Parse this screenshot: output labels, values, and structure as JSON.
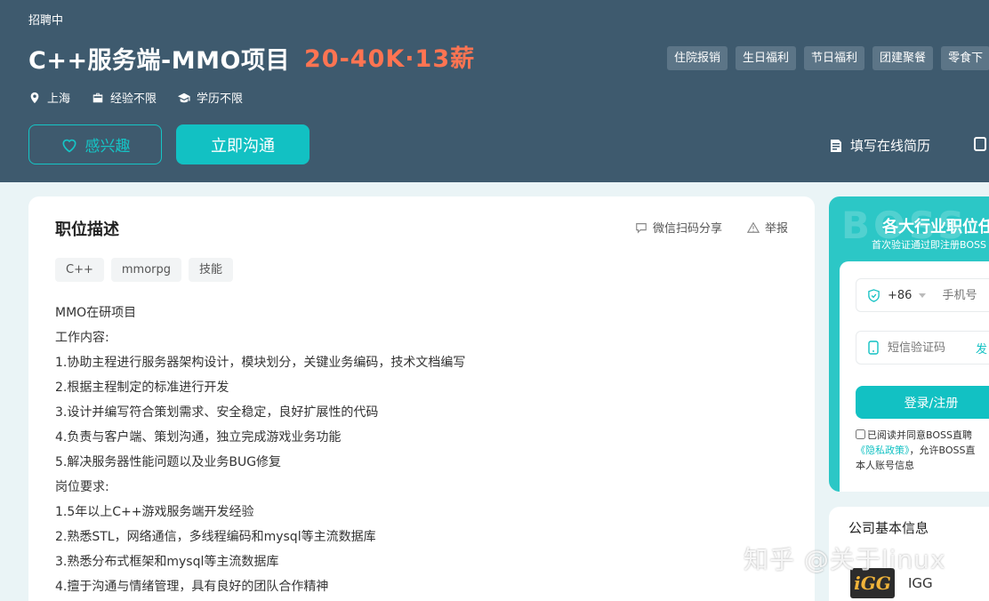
{
  "header": {
    "status": "招聘中",
    "job_title": "C++服务端-MMO项目",
    "salary": "20-40K·13薪",
    "benefits": [
      "住院报销",
      "生日福利",
      "节日福利",
      "团建聚餐",
      "零食下"
    ],
    "meta": {
      "location": "上海",
      "experience": "经验不限",
      "education": "学历不限"
    },
    "interest_label": "感兴趣",
    "chat_label": "立即沟通",
    "resume_label": "填写在线简历"
  },
  "job": {
    "section_title": "职位描述",
    "share_label": "微信扫码分享",
    "report_label": "举报",
    "skill_tags": [
      "C++",
      "mmorpg",
      "技能"
    ],
    "description": [
      "MMO在研项目",
      "工作内容:",
      "1.协助主程进行服务器架构设计，模块划分，关键业务编码，技术文档编写",
      "2.根据主程制定的标准进行开发",
      "3.设计并编写符合策划需求、安全稳定，良好扩展性的代码",
      "4.负责与客户端、策划沟通，独立完成游戏业务功能",
      "5.解决服务器性能问题以及业务BUG修复",
      "岗位要求:",
      "1.5年以上C++游戏服务端开发经验",
      "2.熟悉STL，网络通信，多线程编码和mysql等主流数据库",
      "3.熟悉分布式框架和mysql等主流数据库",
      "4.擅于沟通与情绪管理，具有良好的团队合作精神"
    ]
  },
  "login": {
    "watermark": "BOSS",
    "headline": "各大行业职位任",
    "subline": "首次验证通过即注册BOSS",
    "country_code": "+86",
    "phone_placeholder": "手机号",
    "code_placeholder": "短信验证码",
    "send_code_label": "发",
    "login_label": "登录/注册",
    "agree_text": "已阅读并同意BOSS直聘",
    "privacy_link": "《隐私政策》",
    "agree_text2": "，允许BOSS直",
    "agree_text3": "本人账号信息"
  },
  "company": {
    "title": "公司基本信息",
    "logo_text": "iGG",
    "name": "IGG"
  },
  "overlay": {
    "watermark": "知乎 @关于linux"
  },
  "colors": {
    "header_bg": "#3e5a6e",
    "accent": "#12c1c3",
    "salary": "#ff7452"
  }
}
